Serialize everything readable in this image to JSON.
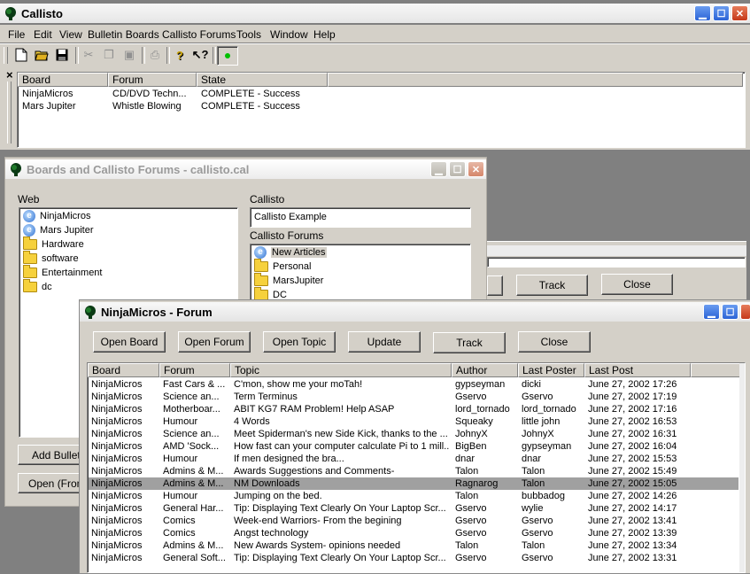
{
  "app": {
    "title": "Callisto",
    "menu": [
      "File",
      "Edit",
      "View",
      "Bulletin Boards",
      "Callisto Forums",
      "Tools",
      "Window",
      "Help"
    ],
    "toolbar": {
      "new_icon": "new-document-icon",
      "open_icon": "open-folder-icon",
      "save_icon": "save-icon",
      "cut_icon": "cut-icon",
      "copy_icon": "copy-icon",
      "paste_icon": "paste-icon",
      "print_icon": "print-icon",
      "help_icon": "help-icon",
      "whats_this_icon": "whats-this-icon",
      "status_icon": "status-light-icon",
      "status_color": "#00c000"
    },
    "close_panel_glyph": "×"
  },
  "jobs": {
    "columns": [
      "Board",
      "Forum",
      "State"
    ],
    "rows": [
      {
        "board": "NinjaMicros",
        "forum": "CD/DVD Techn...",
        "state": "COMPLETE - Success"
      },
      {
        "board": "Mars Jupiter",
        "forum": "Whistle Blowing",
        "state": "COMPLETE - Success"
      }
    ]
  },
  "boards_window": {
    "title": "Boards and Callisto Forums - callisto.cal",
    "web_label": "Web",
    "web_items": [
      {
        "label": "NinjaMicros",
        "icon": "ie-icon"
      },
      {
        "label": "Mars Jupiter",
        "icon": "ie-icon"
      },
      {
        "label": "Hardware",
        "icon": "folder-icon"
      },
      {
        "label": "software",
        "icon": "folder-icon"
      },
      {
        "label": "Entertainment",
        "icon": "folder-icon"
      },
      {
        "label": "dc",
        "icon": "folder-icon"
      }
    ],
    "callisto_label": "Callisto",
    "callisto_value": "Callisto Example",
    "forums_label": "Callisto Forums",
    "forum_items": [
      {
        "label": "New Articles",
        "icon": "ie-icon"
      },
      {
        "label": "Personal",
        "icon": "folder-icon"
      },
      {
        "label": "MarsJupiter",
        "icon": "folder-icon"
      },
      {
        "label": "DC",
        "icon": "folder-icon"
      }
    ],
    "add_button": "Add Bulletin",
    "open_button": "Open (From"
  },
  "hidden_window": {
    "track_button": "Track",
    "close_button": "Close"
  },
  "forum_window": {
    "title": "NinjaMicros - Forum",
    "buttons": [
      "Open Board",
      "Open Forum",
      "Open Topic",
      "Update",
      "Track",
      "Close"
    ],
    "columns": [
      "Board",
      "Forum",
      "Topic",
      "Author",
      "Last Poster",
      "Last Post"
    ],
    "selected_row": 8,
    "rows": [
      {
        "board": "NinjaMicros",
        "forum": "Fast Cars & ...",
        "topic": "C'mon, show me your moTah!",
        "author": "gypseyman",
        "poster": "dicki",
        "last": "June 27, 2002 17:26"
      },
      {
        "board": "NinjaMicros",
        "forum": "Science an...",
        "topic": "Term Terminus",
        "author": "Gservo",
        "poster": "Gservo",
        "last": "June 27, 2002 17:19"
      },
      {
        "board": "NinjaMicros",
        "forum": "Motherboar...",
        "topic": "ABIT KG7 RAM Problem! Help ASAP",
        "author": "lord_tornado",
        "poster": "lord_tornado",
        "last": "June 27, 2002 17:16"
      },
      {
        "board": "NinjaMicros",
        "forum": "Humour",
        "topic": "4 Words",
        "author": "Squeaky",
        "poster": "little john",
        "last": "June 27, 2002 16:53"
      },
      {
        "board": "NinjaMicros",
        "forum": "Science an...",
        "topic": "Meet Spiderman's new Side Kick, thanks to the ...",
        "author": "JohnyX",
        "poster": "JohnyX",
        "last": "June 27, 2002 16:31"
      },
      {
        "board": "NinjaMicros",
        "forum": "AMD 'Sock...",
        "topic": "How fast can your computer calculate Pi to 1 mill...",
        "author": "BigBen",
        "poster": "gypseyman",
        "last": "June 27, 2002 16:04"
      },
      {
        "board": "NinjaMicros",
        "forum": "Humour",
        "topic": "If men designed the bra...",
        "author": "dnar",
        "poster": "dnar",
        "last": "June 27, 2002 15:53"
      },
      {
        "board": "NinjaMicros",
        "forum": "Admins & M...",
        "topic": "Awards Suggestions and Comments-",
        "author": "Talon",
        "poster": "Talon",
        "last": "June 27, 2002 15:49"
      },
      {
        "board": "NinjaMicros",
        "forum": "Admins & M...",
        "topic": "NM Downloads",
        "author": "Ragnarog",
        "poster": "Talon",
        "last": "June 27, 2002 15:05"
      },
      {
        "board": "NinjaMicros",
        "forum": "Humour",
        "topic": "Jumping on the bed.",
        "author": "Talon",
        "poster": "bubbadog",
        "last": "June 27, 2002 14:26"
      },
      {
        "board": "NinjaMicros",
        "forum": "General Har...",
        "topic": "Tip: Displaying Text Clearly On Your Laptop Scr...",
        "author": "Gservo",
        "poster": "wylie",
        "last": "June 27, 2002 14:17"
      },
      {
        "board": "NinjaMicros",
        "forum": "Comics",
        "topic": "Week-end  Warriors- From the begining",
        "author": "Gservo",
        "poster": "Gservo",
        "last": "June 27, 2002 13:41"
      },
      {
        "board": "NinjaMicros",
        "forum": "Comics",
        "topic": "Angst technology",
        "author": "Gservo",
        "poster": "Gservo",
        "last": "June 27, 2002 13:39"
      },
      {
        "board": "NinjaMicros",
        "forum": "Admins & M...",
        "topic": "New Awards System- opinions needed",
        "author": "Talon",
        "poster": "Talon",
        "last": "June 27, 2002 13:34"
      },
      {
        "board": "NinjaMicros",
        "forum": "General Soft...",
        "topic": "Tip: Displaying Text Clearly On Your Laptop Scr...",
        "author": "Gservo",
        "poster": "Gservo",
        "last": "June 27, 2002 13:31"
      }
    ]
  }
}
